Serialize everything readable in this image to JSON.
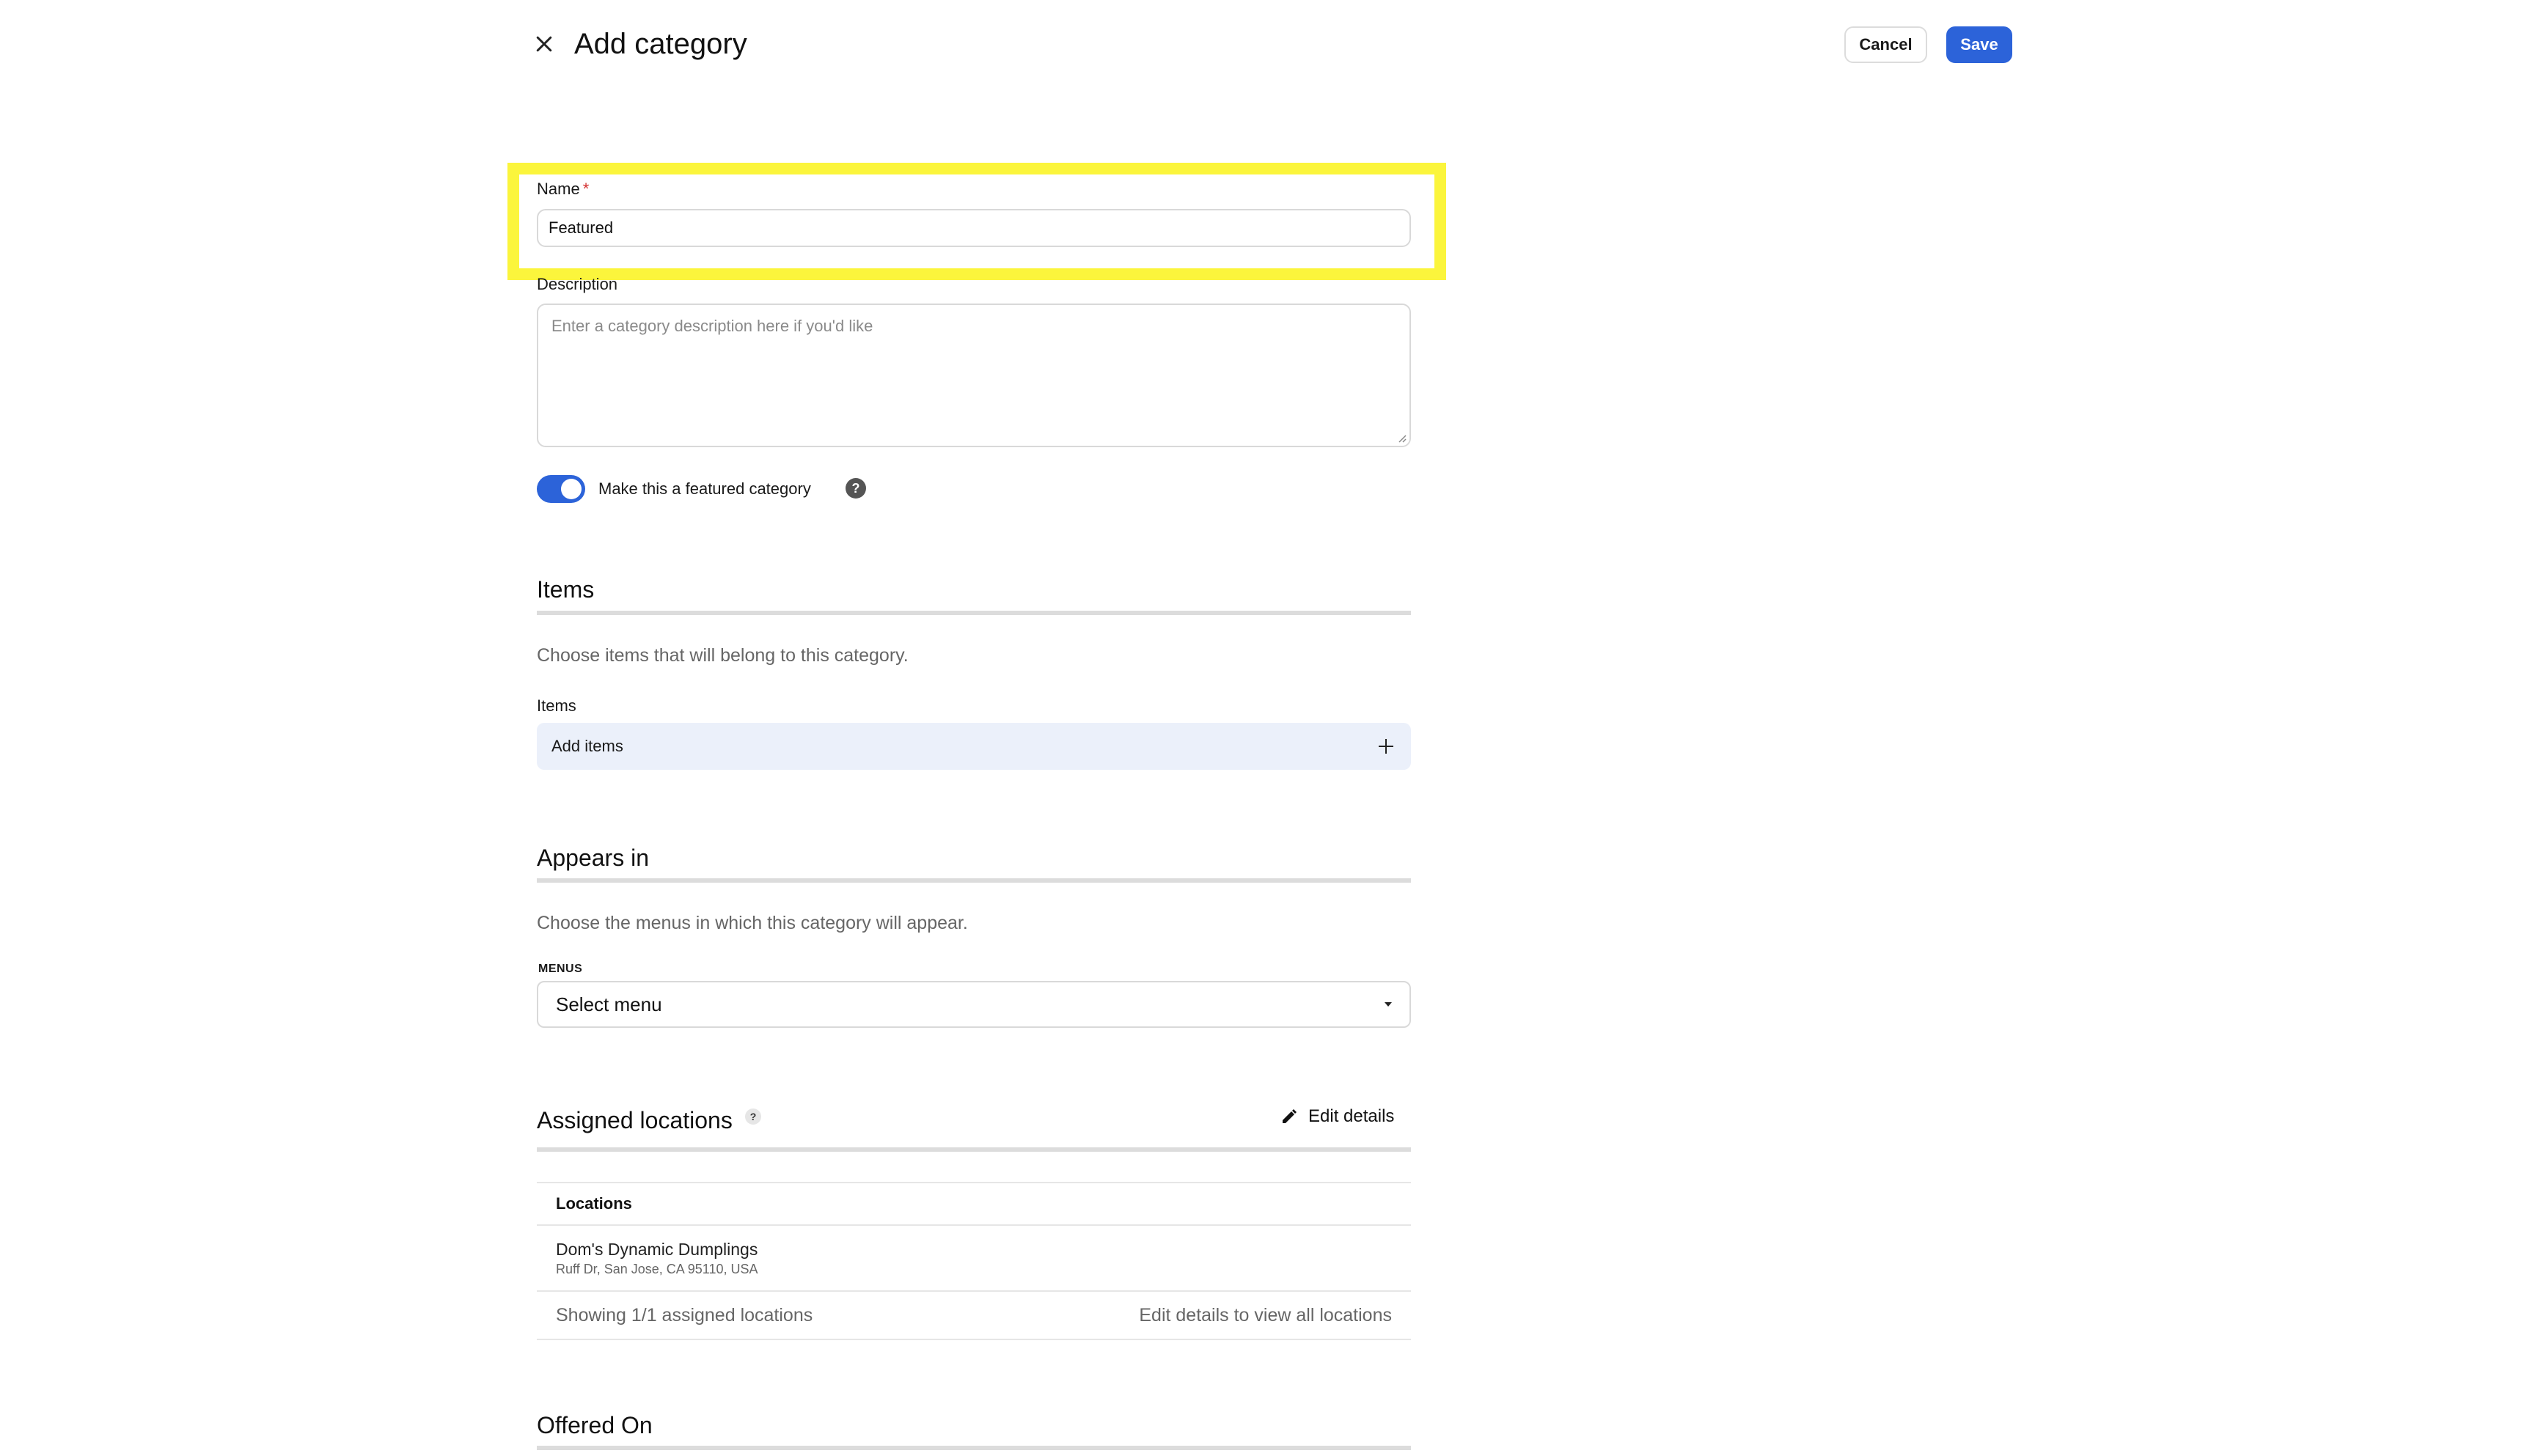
{
  "header": {
    "title": "Add category",
    "cancel_label": "Cancel",
    "save_label": "Save"
  },
  "form": {
    "name": {
      "label": "Name",
      "required_mark": "*",
      "value": "Featured"
    },
    "description": {
      "label": "Description",
      "placeholder": "Enter a category description here if you'd like",
      "value": ""
    },
    "featured_toggle": {
      "label": "Make this a featured category",
      "checked": true,
      "help": "?"
    }
  },
  "items_section": {
    "title": "Items",
    "description": "Choose items that will belong to this category.",
    "sublabel": "Items",
    "add_label": "Add items"
  },
  "appears_in_section": {
    "title": "Appears in",
    "description": "Choose the menus in which this category will appear.",
    "menus_label": "MENUS",
    "select_value": "Select menu"
  },
  "assigned_locations_section": {
    "title": "Assigned locations",
    "help": "?",
    "edit_label": "Edit details",
    "table": {
      "header": "Locations",
      "rows": [
        {
          "name": "Dom's Dynamic Dumplings",
          "address": "Ruff Dr, San Jose, CA 95110, USA"
        }
      ],
      "footer_left": "Showing 1/1 assigned locations",
      "footer_right": "Edit details to view all locations"
    }
  },
  "offered_on_section": {
    "title": "Offered On"
  },
  "colors": {
    "primary": "#2c63d9",
    "highlight": "#fbf53c",
    "required": "#d32f2f",
    "add_items_bg": "#ebf0fa"
  },
  "icons": {
    "close": "close-icon",
    "help": "help-icon",
    "plus": "plus-icon",
    "caret": "chevron-down-icon",
    "edit": "pencil-icon"
  }
}
